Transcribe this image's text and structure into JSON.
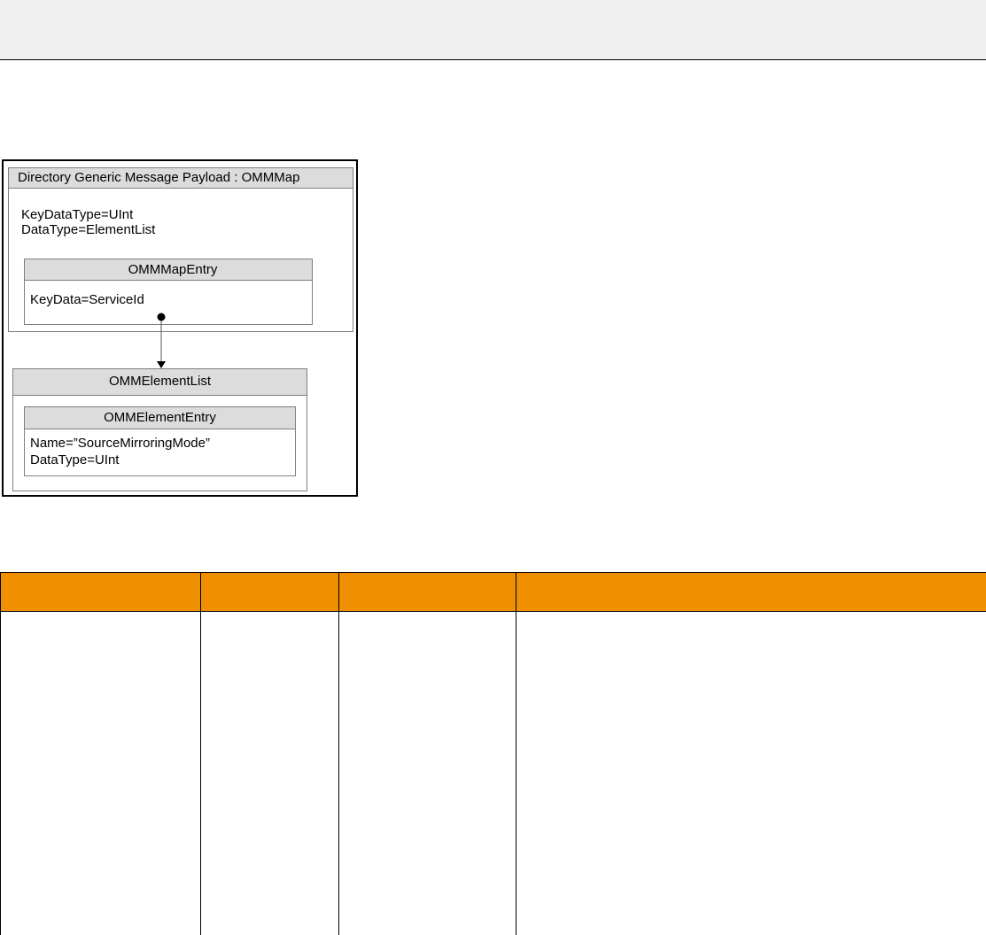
{
  "diagram": {
    "map": {
      "title": "Directory Generic Message Payload : OMMMap",
      "key_data_type": "KeyDataType=UInt",
      "data_type": "DataType=ElementList"
    },
    "map_entry": {
      "title": "OMMMapEntry",
      "key_data": "KeyData=ServiceId"
    },
    "element_list": {
      "title": "OMMElementList"
    },
    "element_entry": {
      "title": "OMMElementEntry",
      "name": "Name=”SourceMirroringMode”",
      "data_type": "DataType=UInt"
    }
  },
  "colors": {
    "table_header": "#f08f00",
    "top_band": "#f0f0f0",
    "uml_title_fill": "#dcdcdc"
  },
  "table": {
    "headers": [
      "",
      "",
      "",
      ""
    ],
    "rows": [
      [
        "",
        "",
        "",
        ""
      ]
    ]
  }
}
